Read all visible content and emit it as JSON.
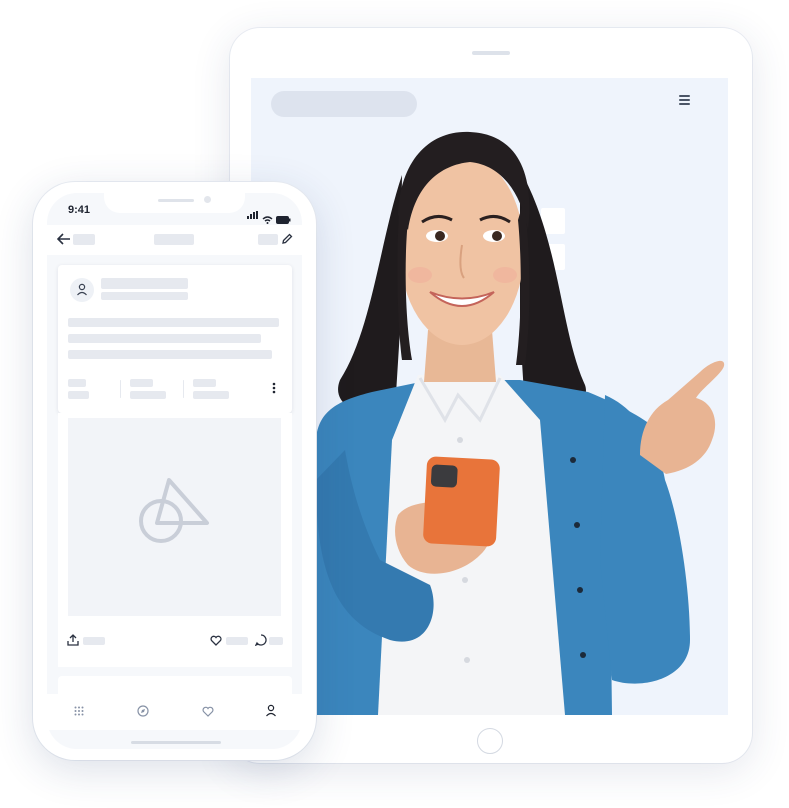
{
  "phone": {
    "status_time": "9:41",
    "icons": {
      "back": "arrow-left-icon",
      "edit": "pencil-icon",
      "avatar": "user-icon",
      "more": "more-vertical-icon",
      "placeholder": "logo-placeholder-icon",
      "share": "share-icon",
      "like": "heart-icon",
      "comment": "comment-icon",
      "nav": [
        "grid-icon",
        "compass-icon",
        "heart-icon",
        "user-icon"
      ]
    }
  },
  "tablet": {
    "icons": {
      "menu": "hamburger-menu-icon"
    }
  },
  "colors": {
    "tablet_screen": "#eff4fc",
    "placeholder": "#e6e9ef",
    "cardigan": "#3b86bd",
    "phone_case": "#e8743a"
  }
}
